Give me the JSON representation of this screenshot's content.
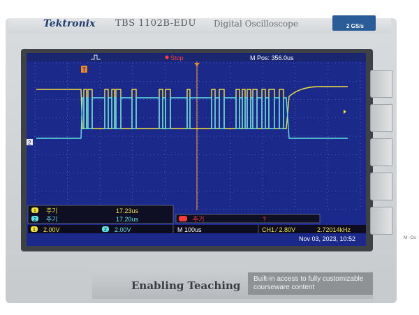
{
  "device": {
    "brand": "Tektronix",
    "model": "TBS 1102B-EDU",
    "subtitle": "Digital Oscilloscope",
    "sample_rate": "2 GS/s",
    "tagline": "Enabling Teaching",
    "tagline_description": "Built-in access to fully customizable courseware content",
    "edge_label": "M- Os"
  },
  "screen": {
    "run_state": "Stop",
    "m_pos": "M Pos: 356.0us",
    "trigger_marker": "T",
    "ch1_marker": "1",
    "ch2_marker": "2",
    "measurements": [
      {
        "channel": "1",
        "label": "주기",
        "value": "17.23us"
      },
      {
        "channel": "2",
        "label": "주기",
        "value": "17.20us"
      }
    ],
    "math": {
      "label": "주기",
      "value": "?"
    },
    "ch1_scale": "2.00V",
    "ch2_scale": "2.00V",
    "timebase": "M 100us",
    "trigger": "CH1 ⁄ 2.80V",
    "trigger_freq": "2.72014kHz",
    "datetime": "Nov 03, 2023, 10:52"
  },
  "colors": {
    "screen_bg": "#1b2a8a",
    "ch1": "#f2e23a",
    "ch2": "#5fe4e8",
    "accent": "#f08a24",
    "run_state": "#ff3a3a"
  }
}
